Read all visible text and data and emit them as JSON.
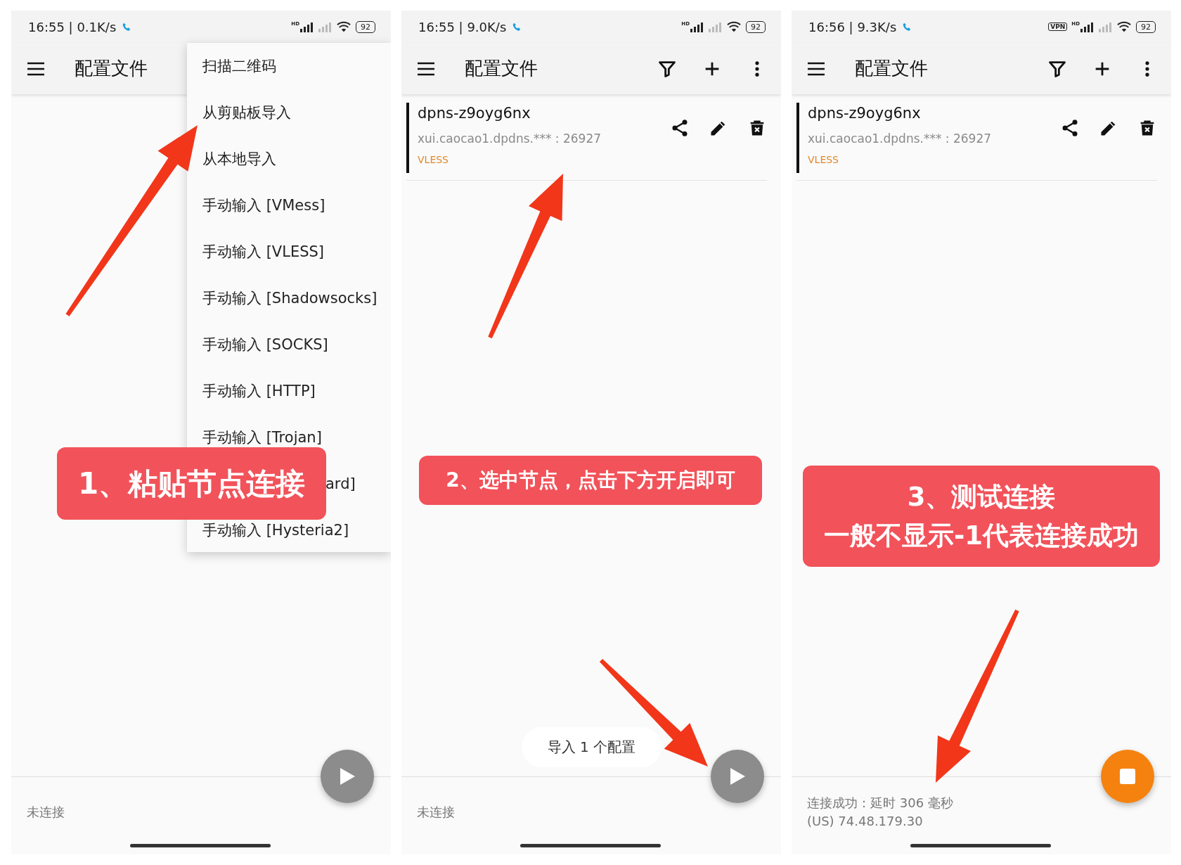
{
  "panels": [
    {
      "status_bar": {
        "time_speed": "16:55 | 0.1K/s",
        "hd_label": "HD",
        "battery": "92"
      },
      "app_bar": {
        "title": "配置文件"
      },
      "menu": {
        "items": [
          {
            "label": "扫描二维码",
            "kind": "full"
          },
          {
            "label": "从剪贴板导入",
            "kind": "full"
          },
          {
            "label": "从本地导入",
            "kind": "full"
          },
          {
            "label": "手动输入 [VMess]",
            "kind": "full"
          },
          {
            "label": "手动输入 [VLESS]",
            "kind": "full"
          },
          {
            "label": "手动输入 [Shadowsocks]",
            "kind": "full"
          },
          {
            "label": "手动输入 [SOCKS]",
            "kind": "full"
          },
          {
            "label": "手动输入 [HTTP]",
            "kind": "full"
          },
          {
            "label": "手动输入 [Trojan]",
            "kind": "full"
          },
          {
            "label": "ard]",
            "kind": "covered"
          },
          {
            "label": "手动输入 [Hysteria2]",
            "kind": "full"
          }
        ]
      },
      "callout": {
        "kind": "large",
        "lines": [
          "1、粘贴节点连接"
        ]
      },
      "fab": {
        "running": false
      },
      "footer": [
        "未连接"
      ]
    },
    {
      "status_bar": {
        "time_speed": "16:55 | 9.0K/s",
        "hd_label": "HD",
        "battery": "92"
      },
      "app_bar": {
        "title": "配置文件",
        "actions": [
          {
            "kind": "filter"
          },
          {
            "kind": "add"
          },
          {
            "kind": "more"
          }
        ]
      },
      "profiles": [
        {
          "name": "dpns-z9oyg6nx",
          "address": "xui.caocao1.dpdns.*** : 26927",
          "protocol": "VLESS",
          "selected": true
        }
      ],
      "callout": {
        "kind": "medium",
        "lines": [
          "2、选中节点，点击下方开启即可"
        ]
      },
      "toast": "导入 1 个配置",
      "fab": {
        "running": false
      },
      "footer": [
        "未连接"
      ]
    },
    {
      "status_bar": {
        "time_speed": "16:56 | 9.3K/s",
        "vpn_badge": "VPN",
        "hd_label": "HD",
        "battery": "92"
      },
      "app_bar": {
        "title": "配置文件",
        "actions": [
          {
            "kind": "filter"
          },
          {
            "kind": "add"
          },
          {
            "kind": "more"
          }
        ]
      },
      "profiles": [
        {
          "name": "dpns-z9oyg6nx",
          "address": "xui.caocao1.dpdns.*** : 26927",
          "protocol": "VLESS",
          "selected": true
        }
      ],
      "callout": {
        "kind": "two_line",
        "lines": [
          "3、测试连接",
          "一般不显示-1代表连接成功"
        ]
      },
      "fab": {
        "running": true
      },
      "footer": [
        "连接成功：延时 306 毫秒",
        "(US) 74.48.179.30"
      ]
    }
  ]
}
